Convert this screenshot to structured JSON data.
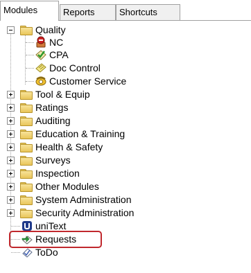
{
  "tabs": [
    {
      "label": "Modules",
      "active": true
    },
    {
      "label": "Reports",
      "active": false
    },
    {
      "label": "Shortcuts",
      "active": false
    }
  ],
  "tree": {
    "quality": {
      "label": "Quality",
      "expanded": true,
      "children": [
        {
          "label": "NC",
          "icon": "nc-icon"
        },
        {
          "label": "CPA",
          "icon": "cpa-checkmark-icon"
        },
        {
          "label": "Doc Control",
          "icon": "doc-control-icon"
        },
        {
          "label": "Customer Service",
          "icon": "customer-service-phone-icon"
        }
      ]
    },
    "folders": [
      {
        "label": "Tool & Equip"
      },
      {
        "label": "Ratings"
      },
      {
        "label": "Auditing"
      },
      {
        "label": "Education & Training"
      },
      {
        "label": "Health & Safety"
      },
      {
        "label": "Surveys"
      },
      {
        "label": "Inspection"
      },
      {
        "label": "Other Modules"
      },
      {
        "label": "System Administration"
      },
      {
        "label": "Security Administration"
      }
    ],
    "leaves": [
      {
        "label": "uniText",
        "icon": "unitext-icon"
      },
      {
        "label": "Requests",
        "icon": "requests-icon",
        "highlighted": true
      },
      {
        "label": "ToDo",
        "icon": "todo-icon"
      }
    ]
  },
  "colors": {
    "highlight_border": "#c0282d",
    "folder_fill": "#f8e39a"
  }
}
